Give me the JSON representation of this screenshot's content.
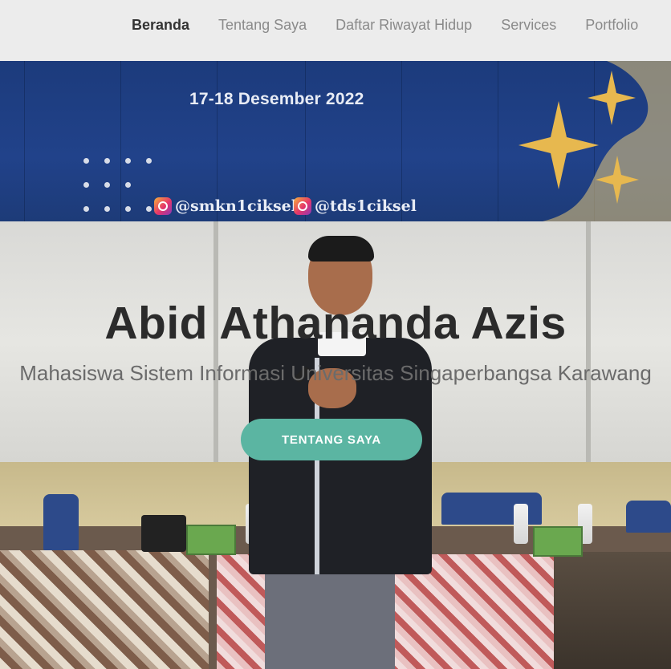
{
  "nav": {
    "items": [
      {
        "label": "Beranda",
        "active": true
      },
      {
        "label": "Tentang Saya",
        "active": false
      },
      {
        "label": "Daftar Riwayat Hidup",
        "active": false
      },
      {
        "label": "Services",
        "active": false
      },
      {
        "label": "Portfolio",
        "active": false
      }
    ]
  },
  "banner": {
    "date": "17-18 Desember 2022",
    "instagram": [
      "@smkn1ciksel",
      "@tds1ciksel"
    ]
  },
  "hero": {
    "name": "Abid Athananda Azis",
    "subtitle": "Mahasiswa Sistem Informasi Universitas Singaperbangsa Karawang",
    "button_label": "TENTANG SAYA"
  },
  "colors": {
    "accent": "#5bb5a2",
    "nav_bg": "#ececec",
    "banner_blue": "#21428a"
  }
}
